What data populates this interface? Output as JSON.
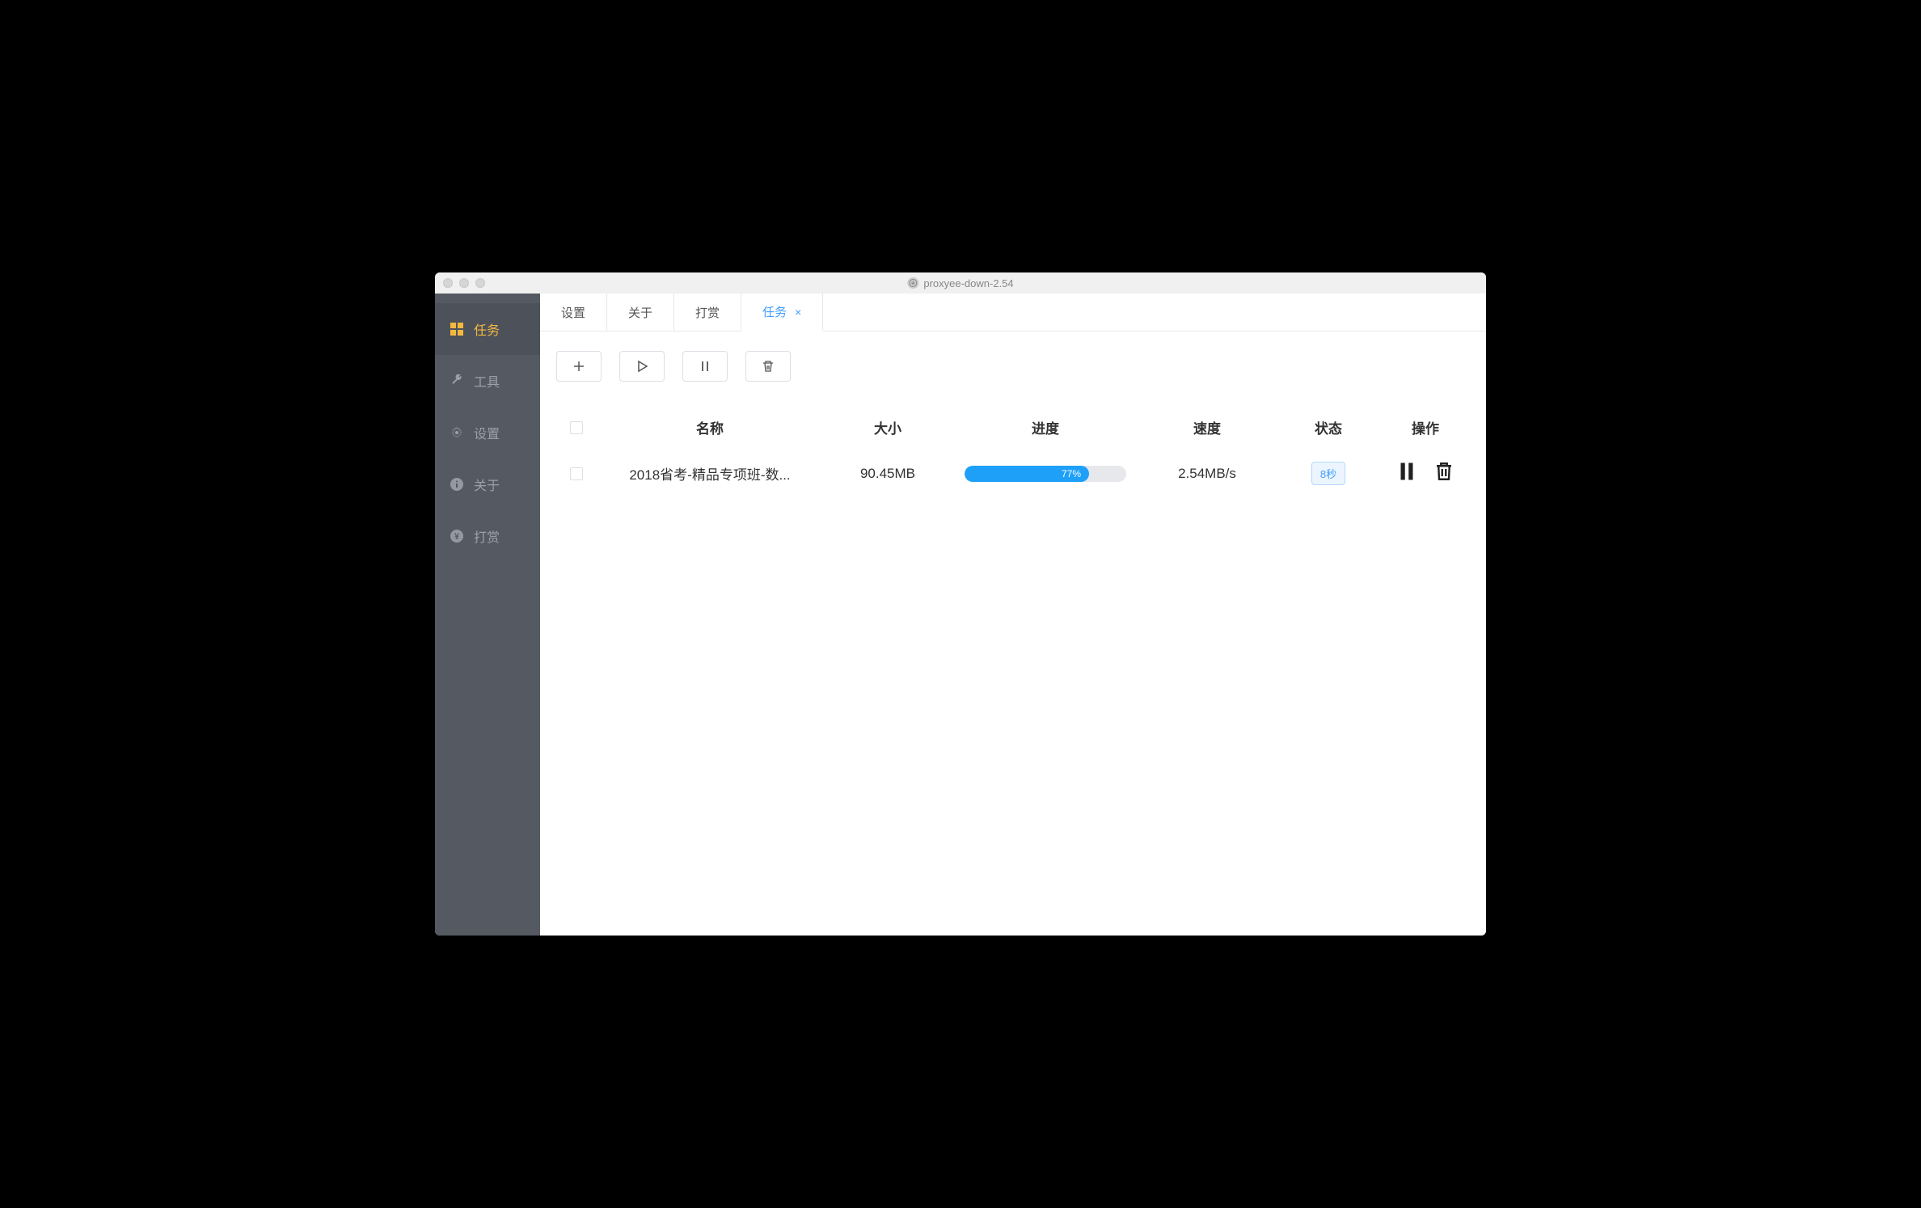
{
  "window": {
    "title": "proxyee-down-2.54"
  },
  "sidebar": {
    "items": [
      {
        "label": "任务",
        "icon": "grid",
        "active": true
      },
      {
        "label": "工具",
        "icon": "wrench",
        "active": false
      },
      {
        "label": "设置",
        "icon": "gear",
        "active": false
      },
      {
        "label": "关于",
        "icon": "info",
        "active": false
      },
      {
        "label": "打赏",
        "icon": "yen",
        "active": false
      }
    ]
  },
  "tabs": [
    {
      "label": "设置",
      "active": false,
      "closable": false
    },
    {
      "label": "关于",
      "active": false,
      "closable": false
    },
    {
      "label": "打赏",
      "active": false,
      "closable": false
    },
    {
      "label": "任务",
      "active": true,
      "closable": true
    }
  ],
  "toolbar": {
    "add_label": "add",
    "play_label": "play",
    "pause_label": "pause",
    "delete_label": "delete"
  },
  "table": {
    "headers": {
      "name": "名称",
      "size": "大小",
      "progress": "进度",
      "speed": "速度",
      "status": "状态",
      "actions": "操作"
    },
    "rows": [
      {
        "name": "2018省考-精品专项班-数...",
        "size": "90.45MB",
        "progress_percent": 77,
        "progress_label": "77%",
        "speed": "2.54MB/s",
        "status": "8秒"
      }
    ]
  }
}
